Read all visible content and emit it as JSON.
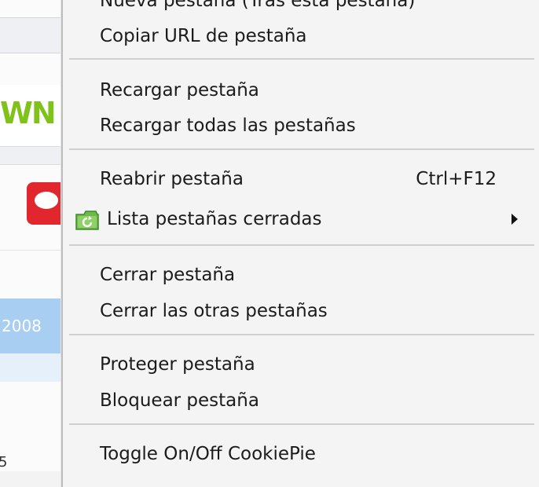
{
  "background": {
    "logo_fragment": "WN",
    "year_fragment": "2008",
    "bottom_fragment": "5"
  },
  "menu": {
    "items": [
      {
        "label": "Nueva pestaña (Tras esta pestaña)"
      },
      {
        "label": "Copiar URL de pestaña"
      },
      {
        "label": "Recargar pestaña"
      },
      {
        "label": "Recargar todas las pestañas"
      },
      {
        "label": "Reabrir pestaña",
        "shortcut": "Ctrl+F12"
      },
      {
        "label": "Lista pestañas cerradas",
        "icon": "closed-tabs-list-icon",
        "submenu": true
      },
      {
        "label": "Cerrar pestaña"
      },
      {
        "label": "Cerrar las otras pestañas"
      },
      {
        "label": "Proteger pestaña"
      },
      {
        "label": "Bloquear pestaña"
      },
      {
        "label": "Toggle On/Off CookiePie"
      }
    ],
    "colors": {
      "background": "#f4f4f4",
      "separator": "#cfcfcf",
      "text": "#1b1b1b"
    }
  }
}
